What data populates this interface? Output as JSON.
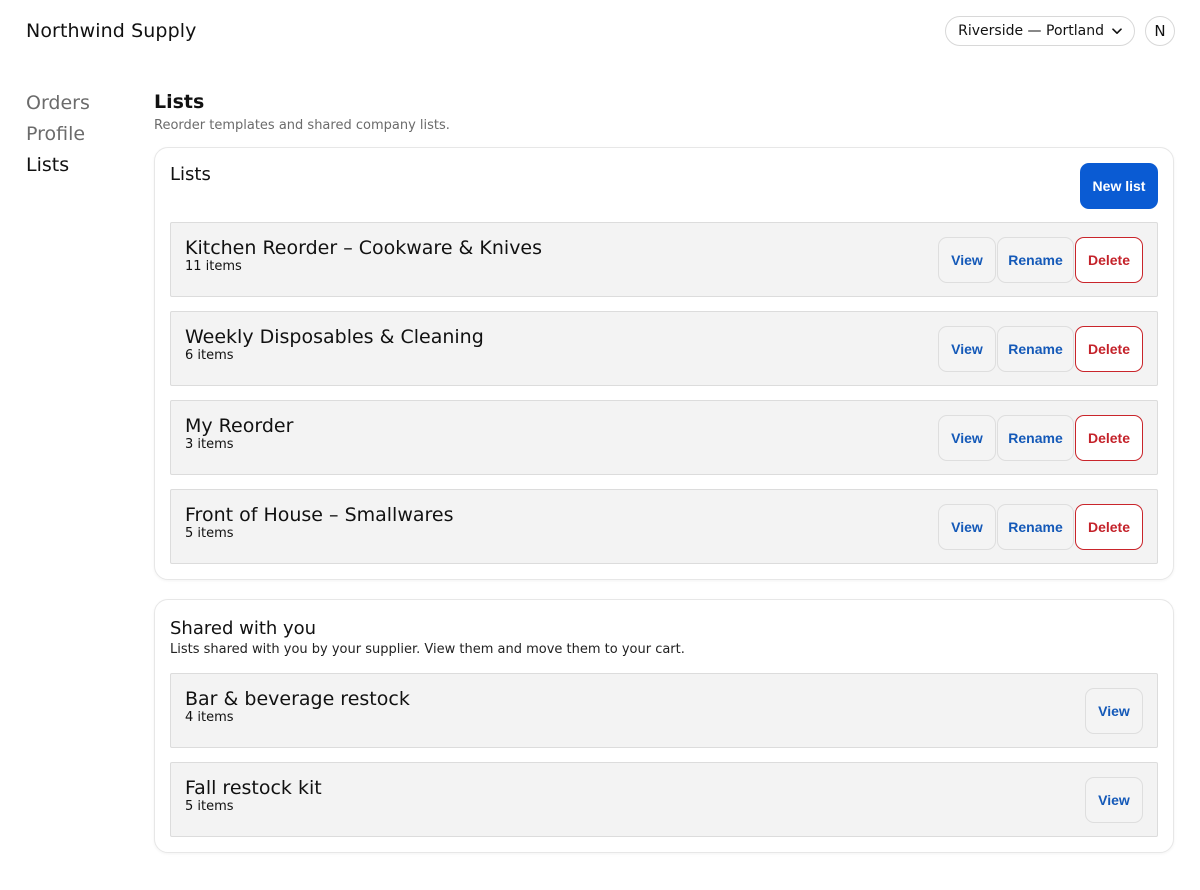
{
  "app": {
    "brand": "Northwind Supply"
  },
  "header": {
    "location": "Riverside — Portland",
    "avatar_initial": "N"
  },
  "sidebar": {
    "items": [
      {
        "label": "Orders",
        "active": false
      },
      {
        "label": "Profile",
        "active": false
      },
      {
        "label": "Lists",
        "active": true
      }
    ]
  },
  "page": {
    "title": "Lists",
    "subtitle": "Reorder templates and shared company lists."
  },
  "lists_card": {
    "title": "Lists",
    "new_button": "New list",
    "view_label": "View",
    "rename_label": "Rename",
    "delete_label": "Delete",
    "items": [
      {
        "name": "Kitchen Reorder – Cookware & Knives",
        "count": "11 items"
      },
      {
        "name": "Weekly Disposables & Cleaning",
        "count": "6 items"
      },
      {
        "name": "My Reorder",
        "count": "3 items"
      },
      {
        "name": "Front of House – Smallwares",
        "count": "5 items"
      }
    ]
  },
  "shared_card": {
    "title": "Shared with you",
    "description": "Lists shared with you by your supplier. View them and move them to your cart.",
    "view_label": "View",
    "items": [
      {
        "name": "Bar & beverage restock",
        "count": "4 items"
      },
      {
        "name": "Fall restock kit",
        "count": "5 items"
      }
    ]
  },
  "colors": {
    "primary": "#0a5bd3",
    "danger": "#c4222a",
    "link": "#1459b8"
  },
  "icons": {
    "location_chevron": "chevron-down-icon"
  }
}
